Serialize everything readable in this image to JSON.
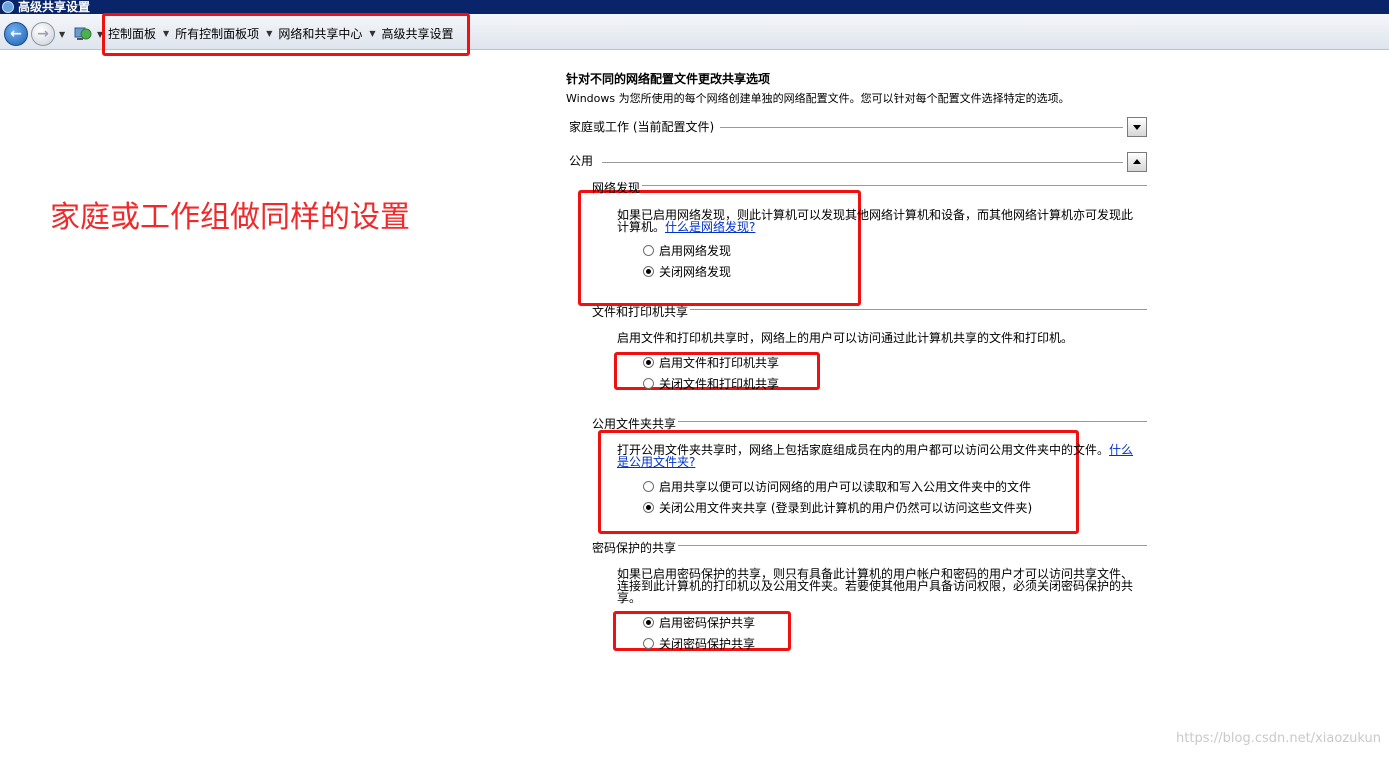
{
  "window": {
    "title": "高级共享设置"
  },
  "toolbar": {
    "breadcrumbs": [
      "控制面板",
      "所有控制面板项",
      "网络和共享中心",
      "高级共享设置"
    ]
  },
  "annotation": {
    "note": "家庭或工作组做同样的设置",
    "box_color": "#f01010"
  },
  "page": {
    "heading": "针对不同的网络配置文件更改共享选项",
    "subheading": "Windows 为您所使用的每个网络创建单独的网络配置文件。您可以针对每个配置文件选择特定的选项。"
  },
  "profiles": [
    {
      "label": "家庭或工作 (当前配置文件)",
      "expanded": false
    },
    {
      "label": "公用",
      "expanded": true
    }
  ],
  "sections": {
    "network_discovery": {
      "title": "网络发现",
      "desc": "如果已启用网络发现，则此计算机可以发现其他网络计算机和设备，而其他网络计算机亦可发现此计算机。",
      "link": "什么是网络发现?",
      "options": [
        {
          "label": "启用网络发现",
          "checked": false
        },
        {
          "label": "关闭网络发现",
          "checked": true
        }
      ]
    },
    "file_printer": {
      "title": "文件和打印机共享",
      "desc": "启用文件和打印机共享时，网络上的用户可以访问通过此计算机共享的文件和打印机。",
      "options": [
        {
          "label": "启用文件和打印机共享",
          "checked": true
        },
        {
          "label": "关闭文件和打印机共享",
          "checked": false
        }
      ]
    },
    "public_folder": {
      "title": "公用文件夹共享",
      "desc": "打开公用文件夹共享时，网络上包括家庭组成员在内的用户都可以访问公用文件夹中的文件。",
      "link": "什么是公用文件夹?",
      "options": [
        {
          "label": "启用共享以便可以访问网络的用户可以读取和写入公用文件夹中的文件",
          "checked": false
        },
        {
          "label": "关闭公用文件夹共享 (登录到此计算机的用户仍然可以访问这些文件夹)",
          "checked": true
        }
      ]
    },
    "password": {
      "title": "密码保护的共享",
      "desc": "如果已启用密码保护的共享，则只有具备此计算机的用户帐户和密码的用户才可以访问共享文件、连接到此计算机的打印机以及公用文件夹。若要使其他用户具备访问权限，必须关闭密码保护的共享。",
      "options": [
        {
          "label": "启用密码保护共享",
          "checked": true
        },
        {
          "label": "关闭密码保护共享",
          "checked": false
        }
      ]
    }
  },
  "watermark": "https://blog.csdn.net/xiaozukun"
}
